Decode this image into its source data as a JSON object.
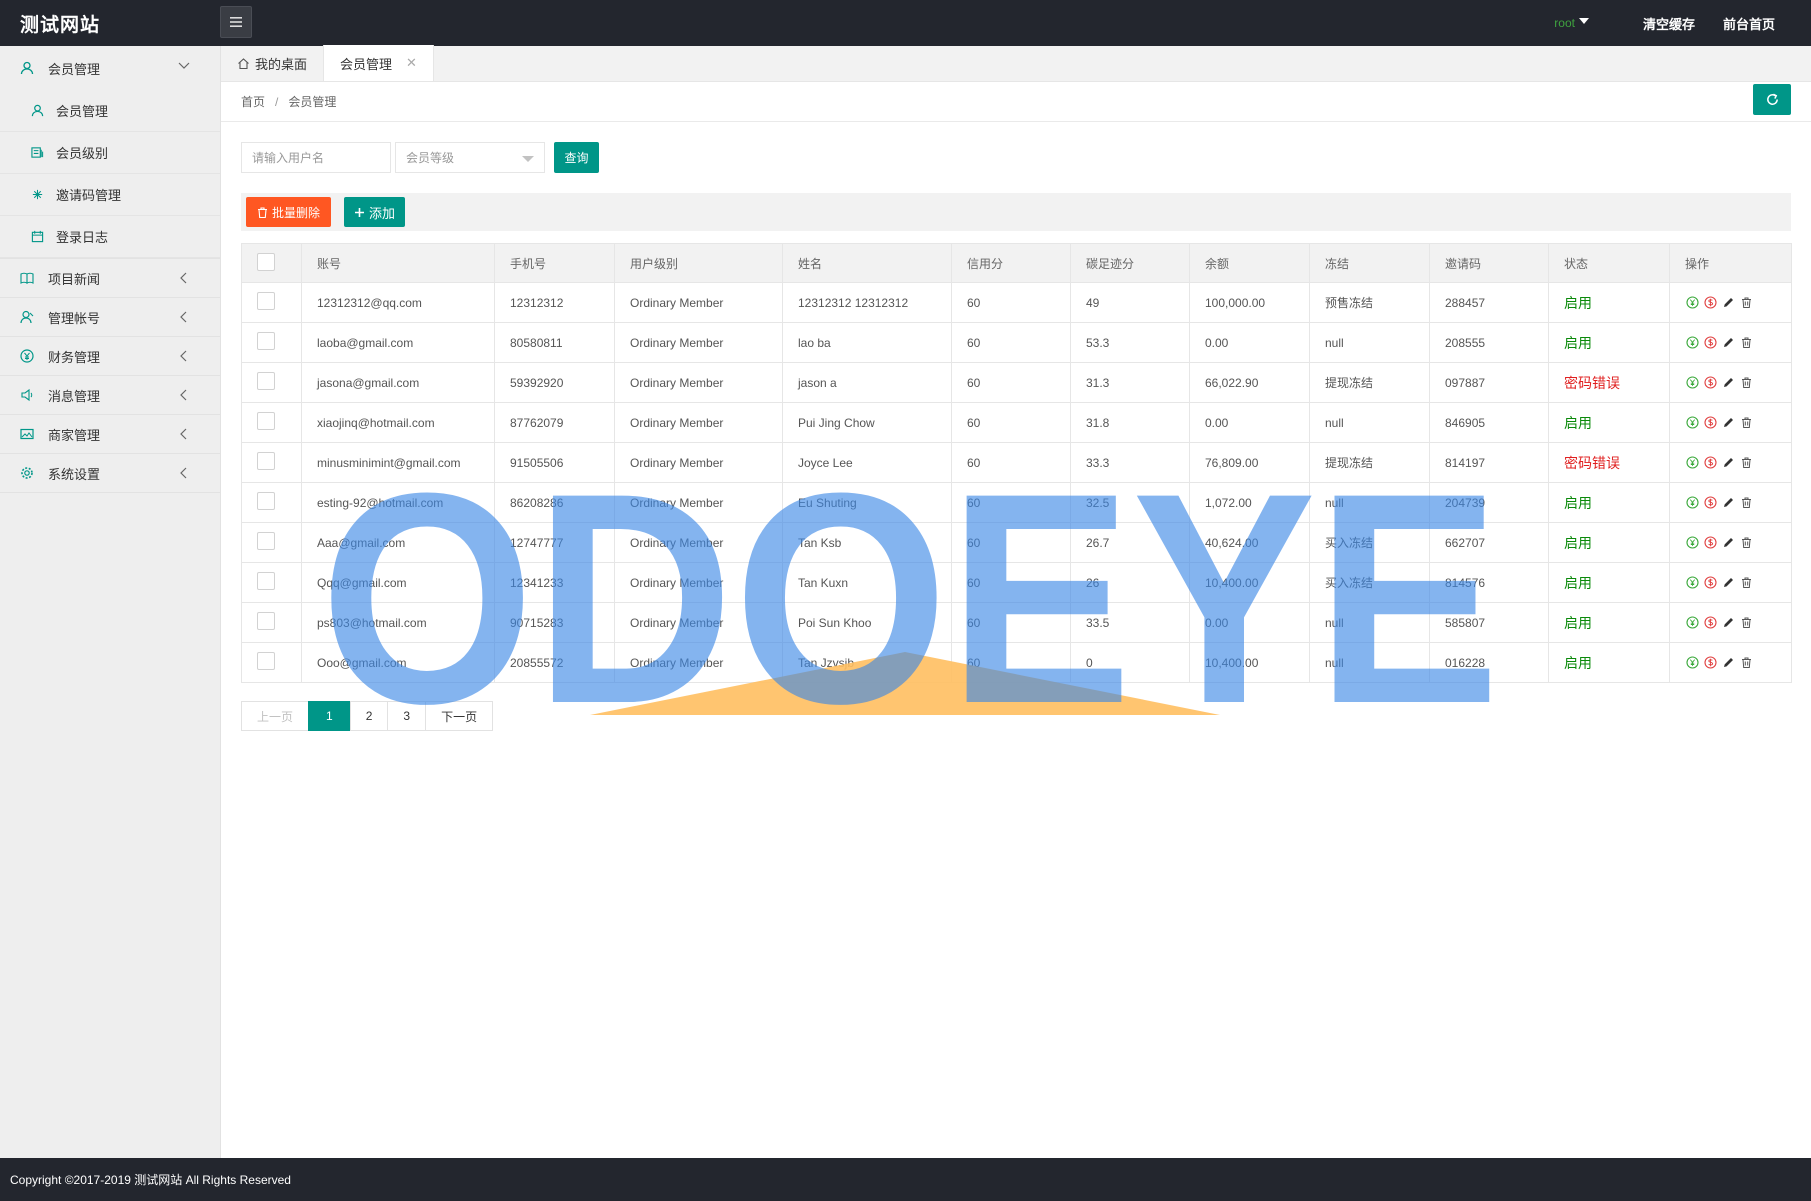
{
  "header": {
    "brand": "测试网站",
    "user": "root",
    "clear_cache": "清空缓存",
    "frontend_home": "前台首页"
  },
  "sidebar": {
    "groups": [
      {
        "label": "会员管理",
        "icon": "user-icon",
        "expanded": true,
        "children": [
          {
            "label": "会员管理",
            "icon": "user-icon"
          },
          {
            "label": "会员级别",
            "icon": "level-icon"
          },
          {
            "label": "邀请码管理",
            "icon": "invite-icon"
          },
          {
            "label": "登录日志",
            "icon": "log-icon"
          }
        ]
      },
      {
        "label": "项目新闻",
        "icon": "book-icon"
      },
      {
        "label": "管理帐号",
        "icon": "admin-icon"
      },
      {
        "label": "财务管理",
        "icon": "finance-icon"
      },
      {
        "label": "消息管理",
        "icon": "message-icon"
      },
      {
        "label": "商家管理",
        "icon": "merchant-icon"
      },
      {
        "label": "系统设置",
        "icon": "gear-icon"
      }
    ]
  },
  "tabs": [
    {
      "label": "我的桌面",
      "icon": "home-icon"
    },
    {
      "label": "会员管理",
      "active": true
    }
  ],
  "breadcrumb": {
    "home": "首页",
    "sep": "/",
    "current": "会员管理"
  },
  "search": {
    "username_placeholder": "请输入用户名",
    "level_placeholder": "会员等级",
    "query_label": "查询"
  },
  "toolbar": {
    "batch_delete": "批量删除",
    "add": "添加"
  },
  "table": {
    "headers": [
      "账号",
      "手机号",
      "用户级别",
      "姓名",
      "信用分",
      "碳足迹分",
      "余额",
      "冻结",
      "邀请码",
      "状态",
      "操作"
    ],
    "rows": [
      {
        "account": "12312312@qq.com",
        "phone": "12312312",
        "level": "Ordinary Member",
        "name": "12312312 12312312",
        "credit": "60",
        "carbon": "49",
        "balance": "100,000.00",
        "frozen": "预售冻结",
        "invite": "288457",
        "status": "启用",
        "status_ok": true
      },
      {
        "account": "laoba@gmail.com",
        "phone": "80580811",
        "level": "Ordinary Member",
        "name": "lao ba",
        "credit": "60",
        "carbon": "53.3",
        "balance": "0.00",
        "frozen": "null",
        "invite": "208555",
        "status": "启用",
        "status_ok": true
      },
      {
        "account": "jasona@gmail.com",
        "phone": "59392920",
        "level": "Ordinary Member",
        "name": "jason a",
        "credit": "60",
        "carbon": "31.3",
        "balance": "66,022.90",
        "frozen": "提现冻结",
        "invite": "097887",
        "status": "密码错误",
        "status_ok": false
      },
      {
        "account": "xiaojinq@hotmail.com",
        "phone": "87762079",
        "level": "Ordinary Member",
        "name": "Pui Jing Chow",
        "credit": "60",
        "carbon": "31.8",
        "balance": "0.00",
        "frozen": "null",
        "invite": "846905",
        "status": "启用",
        "status_ok": true
      },
      {
        "account": "minusminimint@gmail.com",
        "phone": "91505506",
        "level": "Ordinary Member",
        "name": "Joyce Lee",
        "credit": "60",
        "carbon": "33.3",
        "balance": "76,809.00",
        "frozen": "提现冻结",
        "invite": "814197",
        "status": "密码错误",
        "status_ok": false
      },
      {
        "account": "esting-92@hotmail.com",
        "phone": "86208286",
        "level": "Ordinary Member",
        "name": "Eu Shuting",
        "credit": "60",
        "carbon": "32.5",
        "balance": "1,072.00",
        "frozen": "null",
        "invite": "204739",
        "status": "启用",
        "status_ok": true
      },
      {
        "account": "Aaa@gmail.com",
        "phone": "12747777",
        "level": "Ordinary Member",
        "name": "Tan Ksb",
        "credit": "60",
        "carbon": "26.7",
        "balance": "40,624.00",
        "frozen": "买入冻结",
        "invite": "662707",
        "status": "启用",
        "status_ok": true
      },
      {
        "account": "Qqq@gmail.com",
        "phone": "12341233",
        "level": "Ordinary Member",
        "name": "Tan Kuxn",
        "credit": "60",
        "carbon": "26",
        "balance": "10,400.00",
        "frozen": "买入冻结",
        "invite": "814576",
        "status": "启用",
        "status_ok": true
      },
      {
        "account": "ps803@hotmail.com",
        "phone": "90715283",
        "level": "Ordinary Member",
        "name": "Poi Sun Khoo",
        "credit": "60",
        "carbon": "33.5",
        "balance": "0.00",
        "frozen": "null",
        "invite": "585807",
        "status": "启用",
        "status_ok": true
      },
      {
        "account": "Ooo@gmail.com",
        "phone": "20855572",
        "level": "Ordinary Member",
        "name": "Tan Jzvsjb",
        "credit": "60",
        "carbon": "0",
        "balance": "10,400.00",
        "frozen": "null",
        "invite": "016228",
        "status": "启用",
        "status_ok": true
      }
    ]
  },
  "pagination": {
    "prev": "上一页",
    "pages": [
      "1",
      "2",
      "3"
    ],
    "current": "1",
    "next": "下一页"
  },
  "footer": {
    "copyright": "Copyright ©2017-2019 测试网站 All Rights Reserved"
  },
  "watermark": {
    "text": "ODOEYE"
  },
  "colors": {
    "primary": "#009688",
    "danger": "#ff5722",
    "dark": "#23262e",
    "ok": "#0a8a0a",
    "error": "#e02020"
  }
}
